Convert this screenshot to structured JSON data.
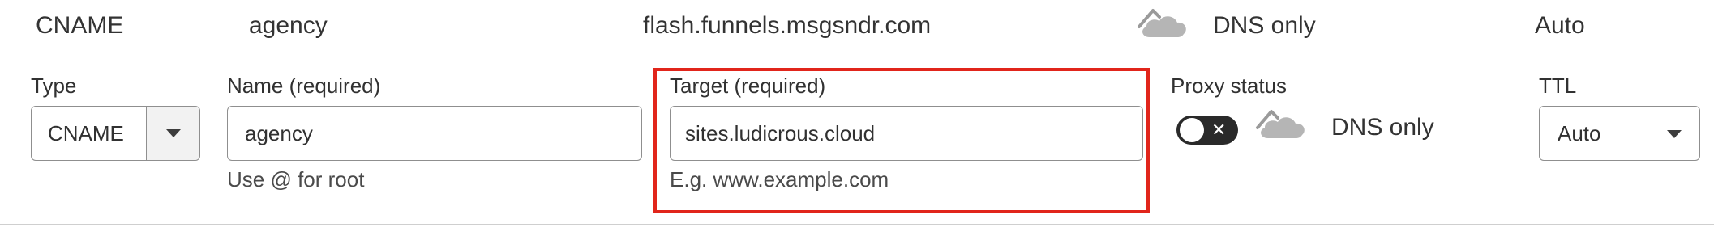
{
  "record": {
    "type": "CNAME",
    "name": "agency",
    "content": "flash.funnels.msgsndr.com",
    "proxy_status": "DNS only",
    "ttl": "Auto"
  },
  "form": {
    "type": {
      "label": "Type",
      "value": "CNAME"
    },
    "name": {
      "label": "Name (required)",
      "value": "agency",
      "hint": "Use @ for root"
    },
    "target": {
      "label": "Target (required)",
      "value": "sites.ludicrous.cloud",
      "hint": "E.g. www.example.com"
    },
    "proxy": {
      "label": "Proxy status",
      "toggle_on": false,
      "status_text": "DNS only"
    },
    "ttl": {
      "label": "TTL",
      "value": "Auto"
    }
  },
  "colors": {
    "highlight": "#e1251b",
    "cloud_gray": "#b5b5b5",
    "toggle_off": "#2a2a2a"
  },
  "icons": {
    "cloud": "cloud-dns-only-icon",
    "caret": "chevron-down-icon",
    "toggle_x": "close-icon"
  }
}
